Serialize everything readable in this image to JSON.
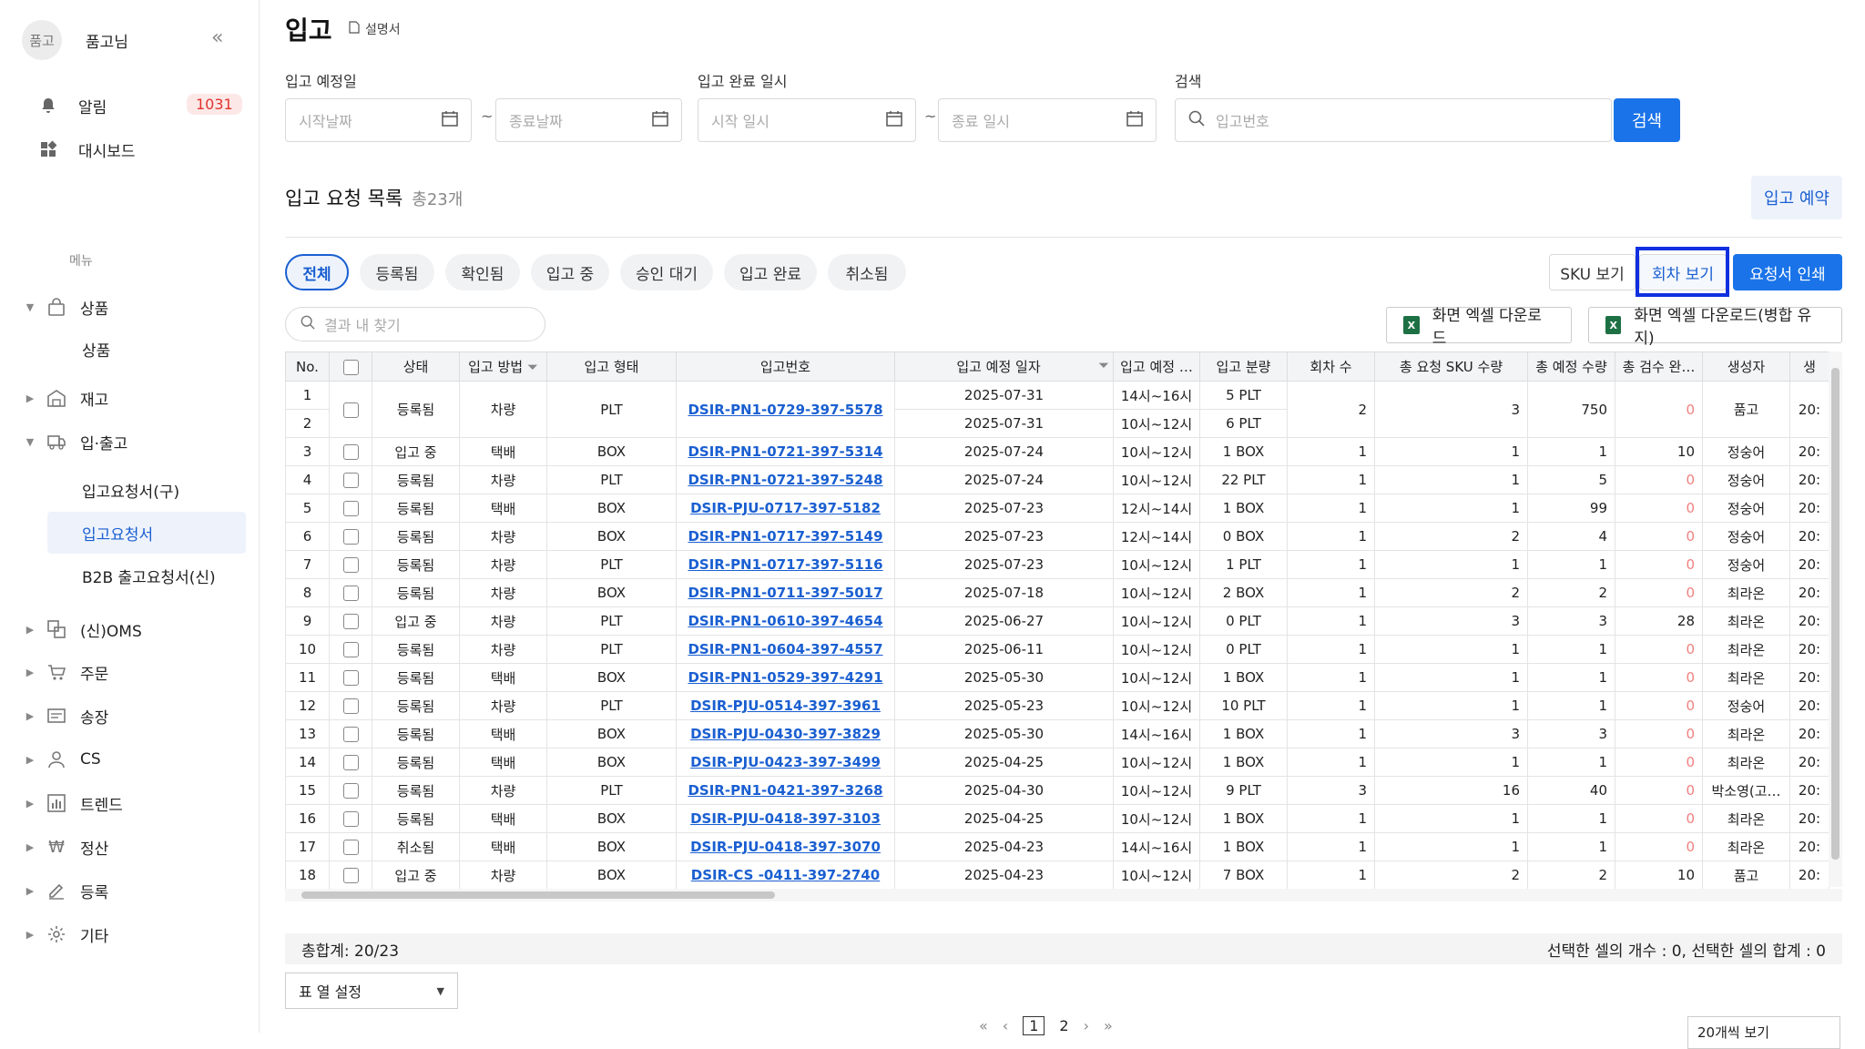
{
  "sidebar": {
    "avatar_text": "품고",
    "username": "품고님",
    "collapse_icon": "«",
    "alarm_label": "알림",
    "alarm_count": "1031",
    "dashboard_label": "대시보드",
    "menu_title": "메뉴",
    "product_label": "상품",
    "product_sub": "상품",
    "stock_label": "재고",
    "inout_label": "입·출고",
    "inbound_old": "입고요청서(구)",
    "inbound": "입고요청서",
    "b2b": "B2B 출고요청서(신)",
    "oms_label": "(신)OMS",
    "order_label": "주문",
    "invoice_label": "송장",
    "cs_label": "CS",
    "trend_label": "트렌드",
    "settle_label": "정산",
    "register_label": "등록",
    "etc_label": "기타"
  },
  "header": {
    "title": "입고",
    "manual": "설명서"
  },
  "filters": {
    "planned_label": "입고 예정일",
    "start_date_ph": "시작날짜",
    "end_date_ph": "종료날짜",
    "done_label": "입고 완료 일시",
    "start_time_ph": "시작 일시",
    "end_time_ph": "종료 일시",
    "search_label": "검색",
    "search_ph": "입고번호",
    "search_btn": "검색",
    "tilde": "~"
  },
  "list": {
    "title": "입고 요청 목록",
    "count": "총23개",
    "reserve_btn": "입고 예약"
  },
  "tabs": [
    "전체",
    "등록됨",
    "확인됨",
    "입고 중",
    "승인 대기",
    "입고 완료",
    "취소됨"
  ],
  "view_buttons": {
    "sku": "SKU 보기",
    "round": "회차 보기",
    "print": "요청서 인쇄"
  },
  "find_ph": "결과 내 찾기",
  "excel": {
    "download": "화면 엑셀 다운로드",
    "download_merge": "화면 엑셀 다운로드(병합 유지)"
  },
  "table": {
    "headers": [
      "No.",
      "",
      "상태",
      "입고 방법",
      "입고 형태",
      "입고번호",
      "입고 예정 일자",
      "입고 예정 …",
      "입고 분량",
      "회차 수",
      "총 요청 SKU 수량",
      "총 예정 수량",
      "총 검수 완…",
      "생성자",
      "생"
    ],
    "merged_group": {
      "status": "등록됨",
      "method": "차량",
      "type": "PLT",
      "id": "DSIR-PN1-0729-397-5578",
      "rounds": "2",
      "sku": "3",
      "planned": "750",
      "inspected": "0",
      "creator": "품고",
      "created": "20:",
      "subrows": [
        {
          "no": "1",
          "date": "2025-07-31",
          "time": "14시~16시",
          "qty": "5 PLT"
        },
        {
          "no": "2",
          "date": "2025-07-31",
          "time": "10시~12시",
          "qty": "6 PLT"
        }
      ]
    },
    "rows": [
      {
        "no": "3",
        "status": "입고 중",
        "method": "택배",
        "type": "BOX",
        "id": "DSIR-PN1-0721-397-5314",
        "date": "2025-07-24",
        "time": "10시~12시",
        "qty": "1 BOX",
        "rounds": "1",
        "sku": "1",
        "planned": "1",
        "inspected": "10",
        "creator": "정숭어",
        "created": "20:"
      },
      {
        "no": "4",
        "status": "등록됨",
        "method": "차량",
        "type": "PLT",
        "id": "DSIR-PN1-0721-397-5248",
        "date": "2025-07-24",
        "time": "10시~12시",
        "qty": "22 PLT",
        "rounds": "1",
        "sku": "1",
        "planned": "5",
        "inspected": "0",
        "creator": "정숭어",
        "created": "20:"
      },
      {
        "no": "5",
        "status": "등록됨",
        "method": "택배",
        "type": "BOX",
        "id": "DSIR-PJU-0717-397-5182",
        "date": "2025-07-23",
        "time": "12시~14시",
        "qty": "1 BOX",
        "rounds": "1",
        "sku": "1",
        "planned": "99",
        "inspected": "0",
        "creator": "정숭어",
        "created": "20:"
      },
      {
        "no": "6",
        "status": "등록됨",
        "method": "차량",
        "type": "BOX",
        "id": "DSIR-PN1-0717-397-5149",
        "date": "2025-07-23",
        "time": "12시~14시",
        "qty": "0 BOX",
        "rounds": "1",
        "sku": "2",
        "planned": "4",
        "inspected": "0",
        "creator": "정숭어",
        "created": "20:"
      },
      {
        "no": "7",
        "status": "등록됨",
        "method": "차량",
        "type": "PLT",
        "id": "DSIR-PN1-0717-397-5116",
        "date": "2025-07-23",
        "time": "10시~12시",
        "qty": "1 PLT",
        "rounds": "1",
        "sku": "1",
        "planned": "1",
        "inspected": "0",
        "creator": "정숭어",
        "created": "20:"
      },
      {
        "no": "8",
        "status": "등록됨",
        "method": "차량",
        "type": "BOX",
        "id": "DSIR-PN1-0711-397-5017",
        "date": "2025-07-18",
        "time": "10시~12시",
        "qty": "2 BOX",
        "rounds": "1",
        "sku": "2",
        "planned": "2",
        "inspected": "0",
        "creator": "최라온",
        "created": "20:"
      },
      {
        "no": "9",
        "status": "입고 중",
        "method": "차량",
        "type": "PLT",
        "id": "DSIR-PN1-0610-397-4654",
        "date": "2025-06-27",
        "time": "10시~12시",
        "qty": "0 PLT",
        "rounds": "1",
        "sku": "3",
        "planned": "3",
        "inspected": "28",
        "creator": "최라온",
        "created": "20:"
      },
      {
        "no": "10",
        "status": "등록됨",
        "method": "차량",
        "type": "PLT",
        "id": "DSIR-PN1-0604-397-4557",
        "date": "2025-06-11",
        "time": "10시~12시",
        "qty": "0 PLT",
        "rounds": "1",
        "sku": "1",
        "planned": "1",
        "inspected": "0",
        "creator": "최라온",
        "created": "20:"
      },
      {
        "no": "11",
        "status": "등록됨",
        "method": "택배",
        "type": "BOX",
        "id": "DSIR-PN1-0529-397-4291",
        "date": "2025-05-30",
        "time": "10시~12시",
        "qty": "1 BOX",
        "rounds": "1",
        "sku": "1",
        "planned": "1",
        "inspected": "0",
        "creator": "최라온",
        "created": "20:"
      },
      {
        "no": "12",
        "status": "등록됨",
        "method": "차량",
        "type": "PLT",
        "id": "DSIR-PJU-0514-397-3961",
        "date": "2025-05-23",
        "time": "10시~12시",
        "qty": "10 PLT",
        "rounds": "1",
        "sku": "1",
        "planned": "1",
        "inspected": "0",
        "creator": "정숭어",
        "created": "20:"
      },
      {
        "no": "13",
        "status": "등록됨",
        "method": "택배",
        "type": "BOX",
        "id": "DSIR-PJU-0430-397-3829",
        "date": "2025-05-30",
        "time": "14시~16시",
        "qty": "1 BOX",
        "rounds": "1",
        "sku": "3",
        "planned": "3",
        "inspected": "0",
        "creator": "최라온",
        "created": "20:"
      },
      {
        "no": "14",
        "status": "등록됨",
        "method": "택배",
        "type": "BOX",
        "id": "DSIR-PJU-0423-397-3499",
        "date": "2025-04-25",
        "time": "10시~12시",
        "qty": "1 BOX",
        "rounds": "1",
        "sku": "1",
        "planned": "1",
        "inspected": "0",
        "creator": "최라온",
        "created": "20:"
      },
      {
        "no": "15",
        "status": "등록됨",
        "method": "차량",
        "type": "PLT",
        "id": "DSIR-PN1-0421-397-3268",
        "date": "2025-04-30",
        "time": "10시~12시",
        "qty": "9 PLT",
        "rounds": "3",
        "sku": "16",
        "planned": "40",
        "inspected": "0",
        "creator": "박소영(고…",
        "created": "20:"
      },
      {
        "no": "16",
        "status": "등록됨",
        "method": "택배",
        "type": "BOX",
        "id": "DSIR-PJU-0418-397-3103",
        "date": "2025-04-25",
        "time": "10시~12시",
        "qty": "1 BOX",
        "rounds": "1",
        "sku": "1",
        "planned": "1",
        "inspected": "0",
        "creator": "최라온",
        "created": "20:"
      },
      {
        "no": "17",
        "status": "취소됨",
        "method": "택배",
        "type": "BOX",
        "id": "DSIR-PJU-0418-397-3070",
        "date": "2025-04-23",
        "time": "14시~16시",
        "qty": "1 BOX",
        "rounds": "1",
        "sku": "1",
        "planned": "1",
        "inspected": "0",
        "creator": "최라온",
        "created": "20:"
      },
      {
        "no": "18",
        "status": "입고 중",
        "method": "차량",
        "type": "BOX",
        "id": "DSIR-CS -0411-397-2740",
        "date": "2025-04-23",
        "time": "10시~12시",
        "qty": "7 BOX",
        "rounds": "1",
        "sku": "2",
        "planned": "2",
        "inspected": "10",
        "creator": "품고",
        "created": "20:"
      }
    ]
  },
  "summary": {
    "total": "총합계: 20/23",
    "selected": "선택한 셀의 개수 : 0, 선택한 셀의 합계 : 0"
  },
  "column_setting": "표 열 설정",
  "pagination": {
    "first": "«",
    "prev": "‹",
    "pages": [
      "1",
      "2"
    ],
    "next": "›",
    "last": "»"
  },
  "page_size": "20개씩 보기",
  "colors": {
    "accent": "#1a73e8",
    "link": "#1a5fd1",
    "badge": "#e0342c",
    "highlight": "#1030e0",
    "zero": "#f08080"
  }
}
